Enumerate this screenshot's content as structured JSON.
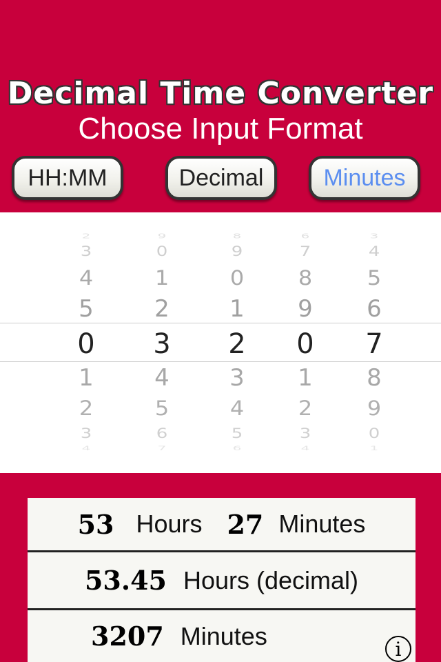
{
  "header": {
    "title": "Decimal Time Converter",
    "subtitle": "Choose Input Format"
  },
  "format_buttons": [
    {
      "label": "HH:MM",
      "active": false
    },
    {
      "label": "Decimal",
      "active": false
    },
    {
      "label": "Minutes",
      "active": true
    }
  ],
  "picker": {
    "selected": [
      "0",
      "3",
      "2",
      "0",
      "7"
    ],
    "columns": [
      [
        "2",
        "3",
        "4",
        "5",
        "0",
        "1",
        "2",
        "3",
        "4"
      ],
      [
        "9",
        "0",
        "1",
        "2",
        "3",
        "4",
        "5",
        "6",
        "7"
      ],
      [
        "8",
        "9",
        "0",
        "1",
        "2",
        "3",
        "4",
        "5",
        "6"
      ],
      [
        "6",
        "7",
        "8",
        "9",
        "0",
        "1",
        "2",
        "3",
        "4"
      ],
      [
        "3",
        "4",
        "5",
        "6",
        "7",
        "8",
        "9",
        "0",
        "1"
      ]
    ]
  },
  "results": {
    "hours_value": "53",
    "hours_label": "Hours",
    "minutes_value": "27",
    "minutes_label": "Minutes",
    "decimal_value": "53.45",
    "decimal_label": "Hours (decimal)",
    "total_minutes_value": "3207",
    "total_minutes_label": "Minutes",
    "info_glyph": "i"
  },
  "colors": {
    "brand_red": "#c8003c",
    "active_button_text": "#5b8ef0"
  }
}
